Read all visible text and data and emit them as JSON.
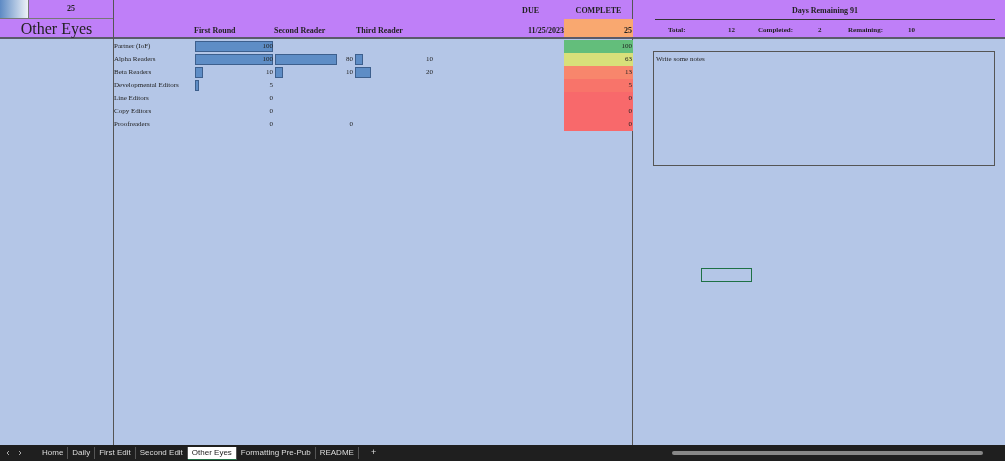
{
  "corner_value": "25",
  "sheet_title": "Other Eyes",
  "round_headers": [
    "First Round",
    "Second Reader",
    "Third Reader"
  ],
  "due": {
    "label": "DUE",
    "date": "11/25/2023"
  },
  "complete": {
    "label": "COMPLETE",
    "value": "25",
    "color": "#f9a870"
  },
  "rows": [
    {
      "name": "Partner (IoF)",
      "rounds": [
        "100"
      ],
      "complete": "100",
      "color": "#63be7b"
    },
    {
      "name": "Alpha Readers",
      "rounds": [
        "100",
        "80",
        "10"
      ],
      "complete": "63",
      "color": "#d8e07a"
    },
    {
      "name": "Beta Readers",
      "rounds": [
        "10",
        "10",
        "20"
      ],
      "complete": "13",
      "color": "#f8866c"
    },
    {
      "name": "Developmental Editors",
      "rounds": [
        "5"
      ],
      "complete": "5",
      "color": "#f8746a"
    },
    {
      "name": "Line Editors",
      "rounds": [
        "0"
      ],
      "complete": "0",
      "color": "#f8696b"
    },
    {
      "name": "Copy Editors",
      "rounds": [
        "0"
      ],
      "complete": "0",
      "color": "#f8696b"
    },
    {
      "name": "Proofreaders",
      "rounds": [
        "0",
        "0"
      ],
      "complete": "0",
      "color": "#f8696b"
    }
  ],
  "summary": {
    "title": "Days Remaining 91",
    "stats": [
      {
        "label": "Total:",
        "value": "12"
      },
      {
        "label": "Completed:",
        "value": "2"
      },
      {
        "label": "Remaining:",
        "value": "10"
      }
    ]
  },
  "notes": "Write some notes",
  "sheet_tabs": [
    {
      "label": "Home",
      "selected": false
    },
    {
      "label": "Daily",
      "selected": false
    },
    {
      "label": "First Edit",
      "selected": false
    },
    {
      "label": "Second Edit",
      "selected": false
    },
    {
      "label": "Other Eyes",
      "selected": true
    },
    {
      "label": "Formatting Pre-Pub",
      "selected": false
    },
    {
      "label": "README",
      "selected": false
    }
  ],
  "add_sheet": "+"
}
